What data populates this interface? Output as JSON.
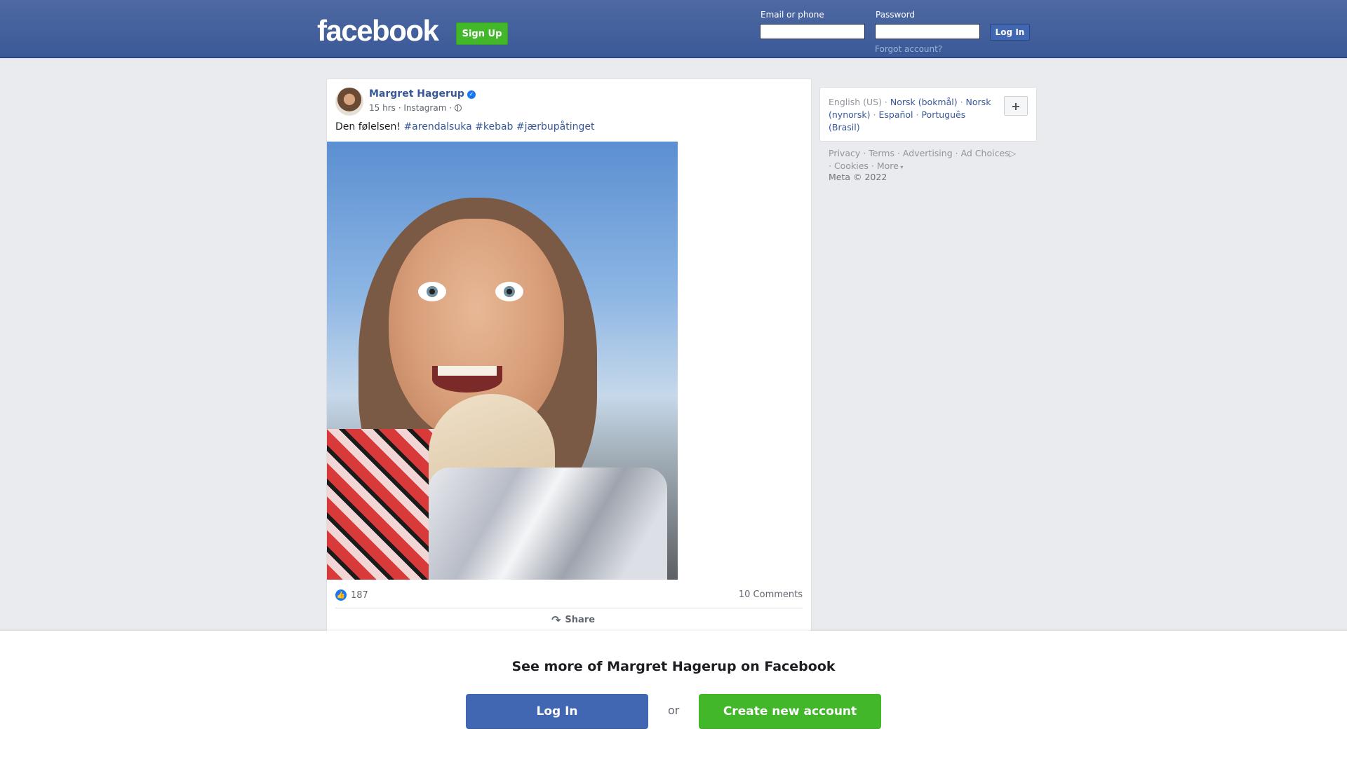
{
  "header": {
    "logo": "facebook",
    "signup_label": "Sign Up",
    "email_label": "Email or phone",
    "email_value": "",
    "password_label": "Password",
    "password_value": "",
    "login_label": "Log In",
    "forgot_label": "Forgot account?"
  },
  "post": {
    "author": "Margret Hagerup",
    "verified_icon": "verified-badge-icon",
    "time": "15 hrs",
    "via": "Instagram",
    "privacy_icon": "globe-icon",
    "text": "Den følelsen!",
    "hashtags": [
      "#arendalsuka",
      "#kebab",
      "#jærbupåtinget"
    ],
    "likes": "187",
    "comments": "10 Comments",
    "share_label": "Share"
  },
  "languages": {
    "current": "English (US)",
    "items": [
      "Norsk (bokmål)",
      "Norsk (nynorsk)",
      "Español",
      "Português (Brasil)"
    ],
    "more_button": "+"
  },
  "footer": {
    "links": [
      "Privacy",
      "Terms",
      "Advertising",
      "Ad Choices",
      "Cookies",
      "More"
    ],
    "copyright": "Meta © 2022"
  },
  "overlay": {
    "title": "See more of Margret Hagerup on Facebook",
    "login_label": "Log In",
    "or_label": "or",
    "create_label": "Create new account"
  },
  "colors": {
    "header_bg": "#3b5998",
    "link": "#385898",
    "green": "#42b72a",
    "login_blue": "#4267b2"
  }
}
